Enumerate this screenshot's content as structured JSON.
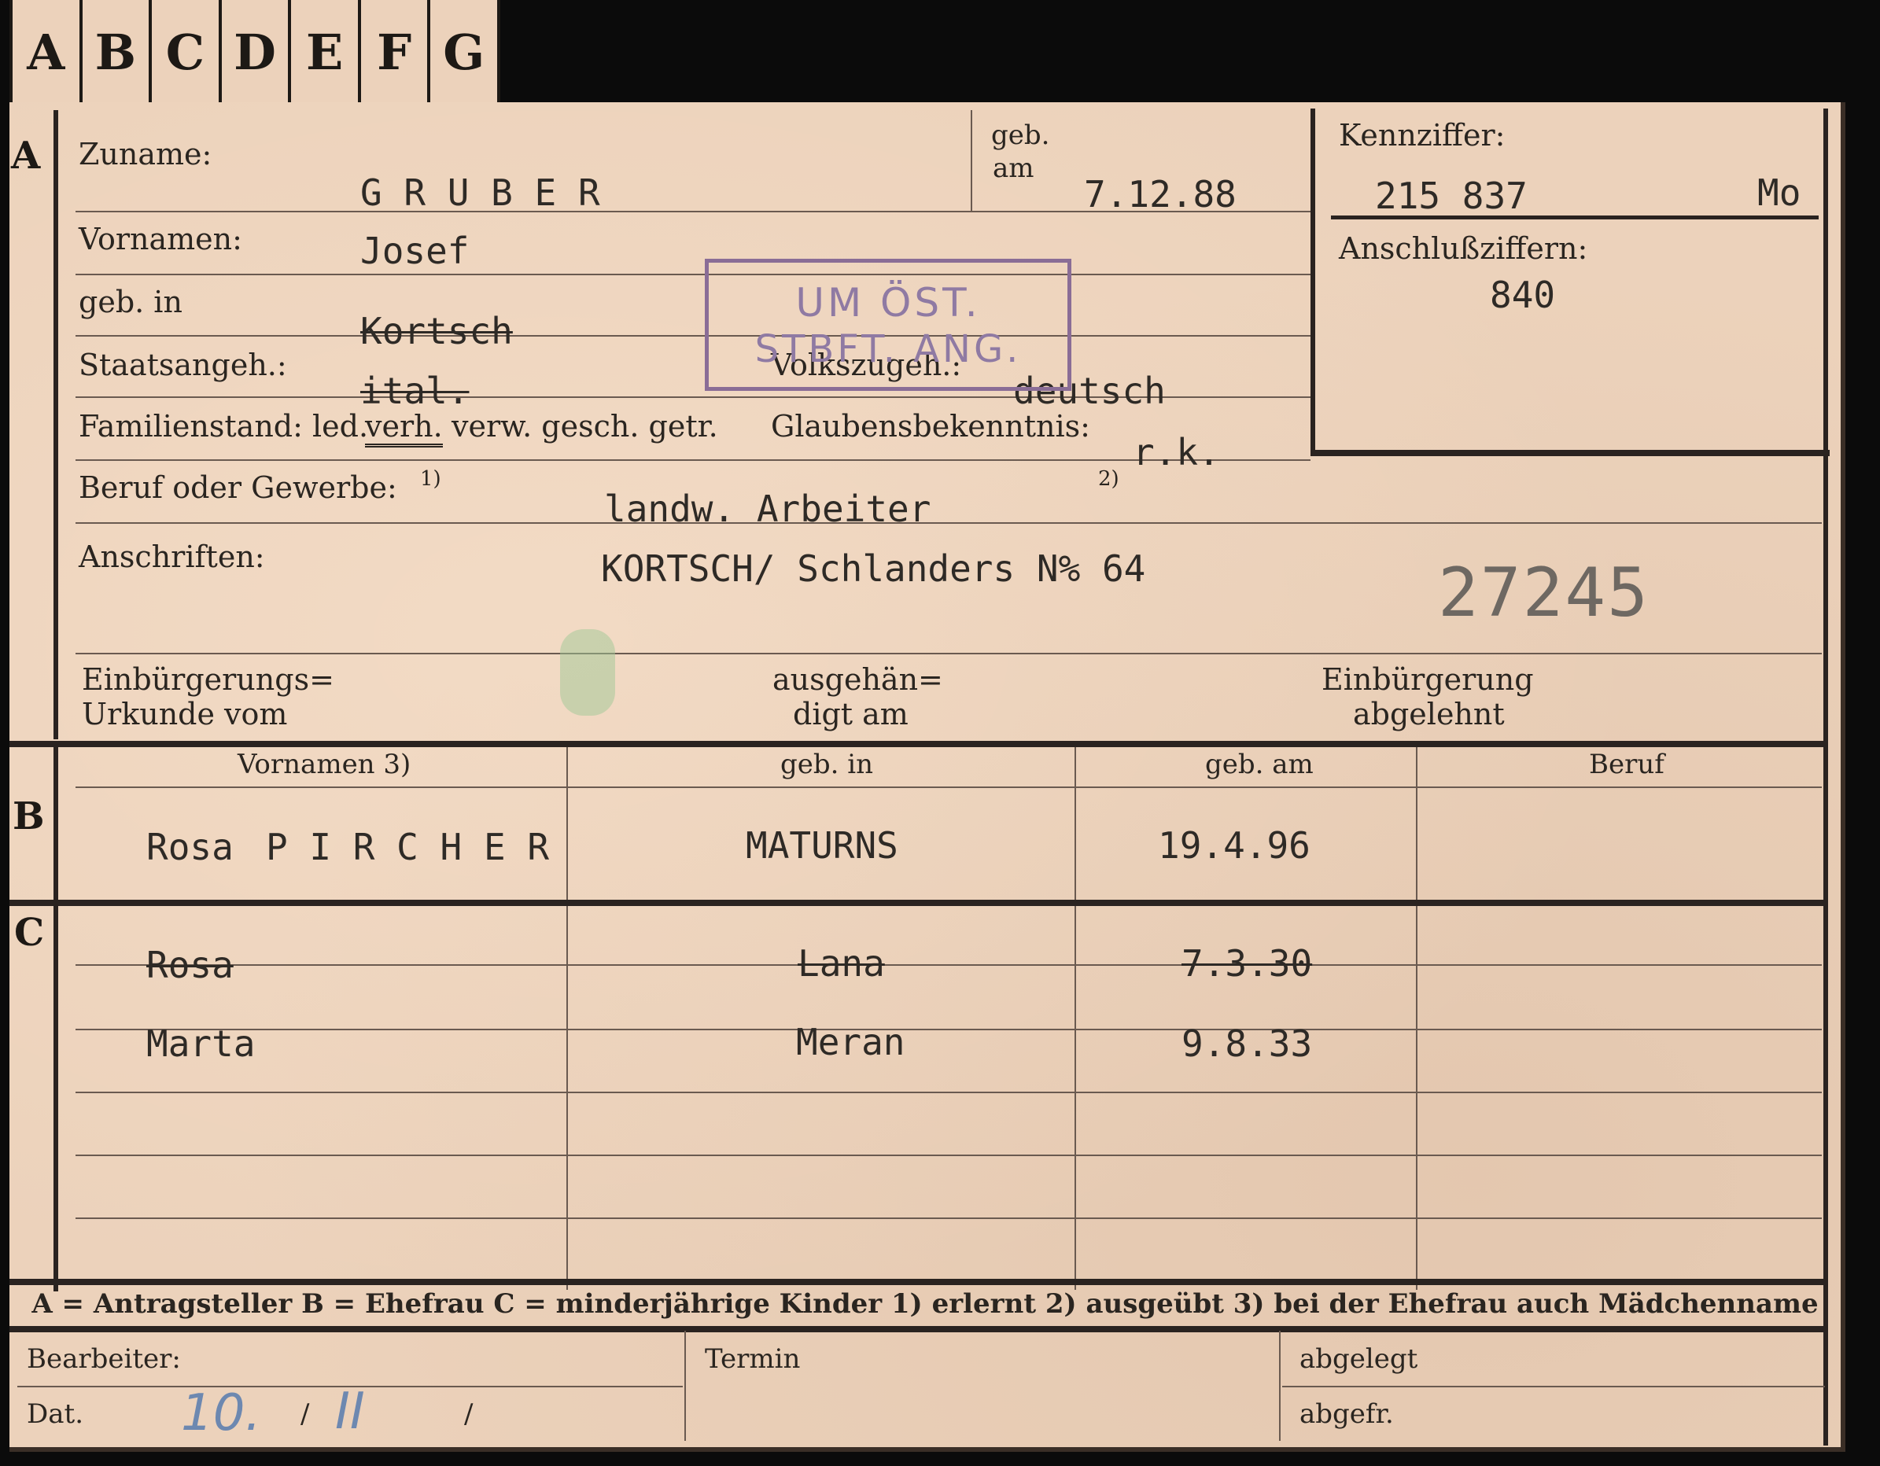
{
  "tabs": [
    "A",
    "B",
    "C",
    "D",
    "E",
    "F",
    "G"
  ],
  "sections": {
    "a": "A",
    "b": "B",
    "c": "C"
  },
  "applicant": {
    "surname_label": "Zuname:",
    "surname": "G R U B E R",
    "born_on_label_1": "geb.",
    "born_on_label_2": "am",
    "born_on": "7.12.88",
    "first_names_label": "Vornamen:",
    "first_names": "Josef",
    "born_in_label": "geb. in",
    "born_in": "Kortsch",
    "citizenship_label": "Staatsangeh.:",
    "citizenship": "ital.",
    "ethnicity_label": "Volkszugeh.:",
    "ethnicity": "deutsch",
    "family_status_label": "Familienstand: led.",
    "family_status_selected": "verh.",
    "family_status_rest": "verw. gesch. getr.",
    "religion_label": "Glaubensbekenntnis:",
    "religion": "r.k.",
    "occupation_label": "Beruf oder Gewerbe:",
    "footnote_1": "1)",
    "footnote_2": "2)",
    "occupation": "landw. Arbeiter",
    "address_label": "Anschriften:",
    "address": "KORTSCH/ Schlanders N% 64",
    "record_number": "27245",
    "naturalization_cert_label_1": "Einbürgerungs=",
    "naturalization_cert_label_2": "Urkunde vom",
    "handed_out_label_1": "ausgehän=",
    "handed_out_label_2": "digt am",
    "naturalization_refused_label_1": "Einbürgerung",
    "naturalization_refused_label_2": "abgelehnt"
  },
  "stamp": {
    "line1": "UM ÖST.",
    "line2": "STBFT. ANG."
  },
  "id_box": {
    "ident_label": "Kennziffer:",
    "ident_value": "215 837",
    "ident_suffix": "Mo",
    "connection_label": "Anschlußziffern:",
    "connection_value": "840"
  },
  "spouse_table": {
    "headers": [
      "Vornamen 3)",
      "geb. in",
      "geb. am",
      "Beruf"
    ],
    "row": {
      "first_name": "Rosa",
      "maiden_name": "P I R C H E R",
      "born_in": "MATURNS",
      "born_on": "19.4.96",
      "occupation": ""
    }
  },
  "children": [
    {
      "name": "Rosa",
      "born_in": "Lana",
      "born_on": "7.3.30",
      "struck": true
    },
    {
      "name": "Marta",
      "born_in": "Meran",
      "born_on": "9.8.33",
      "struck": false
    }
  ],
  "legend": "A = Antragsteller  B = Ehefrau  C = minderjährige Kinder  1) erlernt  2) ausgeübt  3) bei der Ehefrau auch Mädchenname",
  "footer": {
    "clerk_label": "Bearbeiter:",
    "date_label": "Dat.",
    "date_handwritten_day": "10.",
    "date_handwritten_month": "II",
    "date_sep1": "/",
    "date_sep2": "/",
    "deadline_label": "Termin",
    "filed_label": "abgelegt",
    "sent_label": "abgefr."
  },
  "colors": {
    "paper": "#ecd2bb",
    "ink": "#2a2520",
    "stamp": "#8a6d96",
    "pencil": "#6d88b0"
  }
}
